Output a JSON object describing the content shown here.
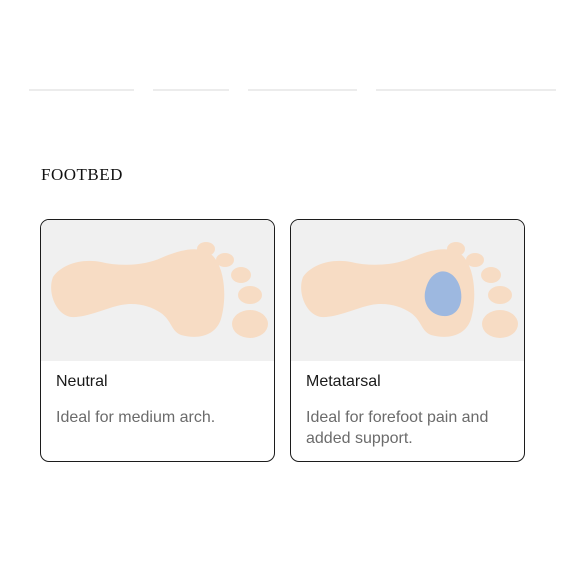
{
  "section": {
    "title": "FOOTBED"
  },
  "options": [
    {
      "title": "Neutral",
      "description": "Ideal for medium arch.",
      "pad": false
    },
    {
      "title": "Metatarsal",
      "description": "Ideal for forefoot pain and added support.",
      "pad": true
    }
  ],
  "colors": {
    "foot": "#f7dcc4",
    "pad": "#9db8e0",
    "media_bg": "#f0f0f0",
    "border": "#1c1c1c"
  },
  "icons": {
    "foot": "footprint-icon",
    "pad": "metatarsal-pad-icon"
  }
}
